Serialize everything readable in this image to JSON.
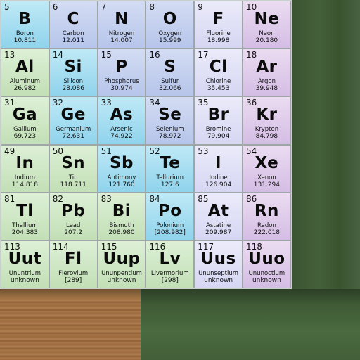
{
  "elements": [
    {
      "number": "5",
      "symbol": "B",
      "name": "Boron",
      "weight": "10.811",
      "category": "metalloid"
    },
    {
      "number": "6",
      "symbol": "C",
      "name": "Carbon",
      "weight": "12.011",
      "category": "reactive-nonmetal"
    },
    {
      "number": "7",
      "symbol": "N",
      "name": "Nitrogen",
      "weight": "14.007",
      "category": "reactive-nonmetal"
    },
    {
      "number": "8",
      "symbol": "O",
      "name": "Oxygen",
      "weight": "15.999",
      "category": "reactive-nonmetal"
    },
    {
      "number": "9",
      "symbol": "F",
      "name": "Fluorine",
      "weight": "18.998",
      "category": "halogen"
    },
    {
      "number": "10",
      "symbol": "Ne",
      "name": "Neon",
      "weight": "20.180",
      "category": "noble-gas"
    },
    {
      "number": "13",
      "symbol": "Al",
      "name": "Aluminum",
      "weight": "26.982",
      "category": "post-transition-metal"
    },
    {
      "number": "14",
      "symbol": "Si",
      "name": "Silicon",
      "weight": "28.086",
      "category": "metalloid"
    },
    {
      "number": "15",
      "symbol": "P",
      "name": "Phosphorus",
      "weight": "30.974",
      "category": "reactive-nonmetal"
    },
    {
      "number": "16",
      "symbol": "S",
      "name": "Sulfur",
      "weight": "32.066",
      "category": "reactive-nonmetal"
    },
    {
      "number": "17",
      "symbol": "Cl",
      "name": "Chlorine",
      "weight": "35.453",
      "category": "halogen"
    },
    {
      "number": "18",
      "symbol": "Ar",
      "name": "Argon",
      "weight": "39.948",
      "category": "noble-gas"
    },
    {
      "number": "31",
      "symbol": "Ga",
      "name": "Gallium",
      "weight": "69.723",
      "category": "post-transition-metal"
    },
    {
      "number": "32",
      "symbol": "Ge",
      "name": "Germanium",
      "weight": "72.631",
      "category": "metalloid"
    },
    {
      "number": "33",
      "symbol": "As",
      "name": "Arsenic",
      "weight": "74.922",
      "category": "metalloid"
    },
    {
      "number": "34",
      "symbol": "Se",
      "name": "Selenium",
      "weight": "78.972",
      "category": "reactive-nonmetal"
    },
    {
      "number": "35",
      "symbol": "Br",
      "name": "Bromine",
      "weight": "79.904",
      "category": "halogen"
    },
    {
      "number": "36",
      "symbol": "Kr",
      "name": "Krypton",
      "weight": "84.798",
      "category": "noble-gas"
    },
    {
      "number": "49",
      "symbol": "In",
      "name": "Indium",
      "weight": "114.818",
      "category": "post-transition-metal"
    },
    {
      "number": "50",
      "symbol": "Sn",
      "name": "Tin",
      "weight": "118.711",
      "category": "post-transition-metal"
    },
    {
      "number": "51",
      "symbol": "Sb",
      "name": "Antimony",
      "weight": "121.760",
      "category": "metalloid"
    },
    {
      "number": "52",
      "symbol": "Te",
      "name": "Tellurium",
      "weight": "127.6",
      "category": "metalloid"
    },
    {
      "number": "53",
      "symbol": "I",
      "name": "Iodine",
      "weight": "126.904",
      "category": "halogen"
    },
    {
      "number": "54",
      "symbol": "Xe",
      "name": "Xenon",
      "weight": "131.294",
      "category": "noble-gas"
    },
    {
      "number": "81",
      "symbol": "Tl",
      "name": "Thallium",
      "weight": "204.383",
      "category": "post-transition-metal"
    },
    {
      "number": "82",
      "symbol": "Pb",
      "name": "Lead",
      "weight": "207.2",
      "category": "post-transition-metal"
    },
    {
      "number": "83",
      "symbol": "Bi",
      "name": "Bismuth",
      "weight": "208.980",
      "category": "post-transition-metal"
    },
    {
      "number": "84",
      "symbol": "Po",
      "name": "Polonium",
      "weight": "[208.982]",
      "category": "metalloid"
    },
    {
      "number": "85",
      "symbol": "At",
      "name": "Astatine",
      "weight": "209.987",
      "category": "halogen"
    },
    {
      "number": "86",
      "symbol": "Rn",
      "name": "Radon",
      "weight": "222.018",
      "category": "noble-gas"
    },
    {
      "number": "113",
      "symbol": "Uut",
      "name": "Ununtrium",
      "weight": "unknown",
      "category": "unknown"
    },
    {
      "number": "114",
      "symbol": "Fl",
      "name": "Flerovium",
      "weight": "[289]",
      "category": "unknown"
    },
    {
      "number": "115",
      "symbol": "Uup",
      "name": "Ununpentium",
      "weight": "unknown",
      "category": "unknown"
    },
    {
      "number": "116",
      "symbol": "Lv",
      "name": "Livermorium",
      "weight": "[298]",
      "category": "unknown"
    },
    {
      "number": "117",
      "symbol": "Uus",
      "name": "Ununseptium",
      "weight": "unknown",
      "category": "halogen"
    },
    {
      "number": "118",
      "symbol": "Uuo",
      "name": "Ununoctium",
      "weight": "unknown",
      "category": "noble-gas"
    }
  ],
  "category_colors": {
    "post-transition-metal": "#cfe8c4",
    "metalloid": "#8fd3ec",
    "reactive-nonmetal": "#b6c5ea",
    "halogen": "#d6d6f3",
    "noble-gas": "#d4bde4",
    "unknown": "#cfe8c4"
  }
}
